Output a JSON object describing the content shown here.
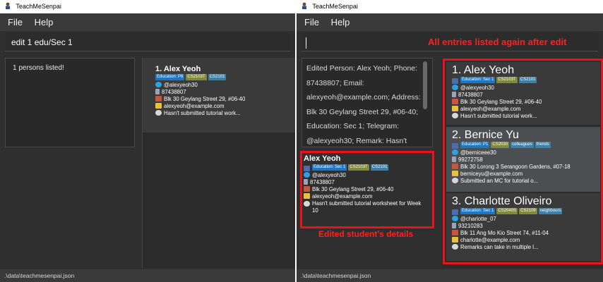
{
  "app_title": "TeachMeSenpai",
  "menu": {
    "file": "File",
    "help": "Help"
  },
  "status_path": ".\\data\\teachmesenpai.json",
  "left": {
    "command_text": "edit 1 edu/Sec 1",
    "result_text": "1 persons listed!",
    "card": {
      "index_name": "1.  Alex Yeoh",
      "tags": [
        "Education: P6",
        "CS2103T",
        "CS2101"
      ],
      "telegram": "@alexyeoh30",
      "phone": "87438807",
      "address": "Blk 30 Geylang Street 29, #06-40",
      "email": "alexyeoh@example.com",
      "remark": "Hasn't submitted tutorial work..."
    }
  },
  "right": {
    "command_text": "",
    "annotation_top": "All entries listed again after edit",
    "annotation_bottom": "Edited student's details",
    "result_text": "Edited Person: Alex Yeoh; Phone: 87438807; Email: alexyeoh@example.com; Address: Blk 30 Geylang Street 29, #06-40; Education: Sec 1; Telegram: @alexyeoh30; Remark: Hasn't submitted",
    "detail": {
      "name": "Alex Yeoh",
      "tags": [
        "Education: Sec 1",
        "CS2103T",
        "CS2101"
      ],
      "telegram": "@alexyeoh30",
      "phone": "87438807",
      "address": "Blk 30 Geylang Street 29, #06-40",
      "email": "alexyeoh@example.com",
      "remark": "Hasn't submitted tutorial worksheet for Week 10"
    },
    "cards": [
      {
        "index_name": "1.  Alex Yeoh",
        "tags": [
          "Education: Sec 1",
          "CS2103T",
          "CS2101"
        ],
        "telegram": "@alexyeoh30",
        "phone": "87438807",
        "address": "Blk 30 Geylang Street 29, #06-40",
        "email": "alexyeoh@example.com",
        "remark": "Hasn't submitted tutorial work..."
      },
      {
        "index_name": "2.  Bernice Yu",
        "tags": [
          "Education: P1",
          "CS2030",
          "colleagues",
          "friends"
        ],
        "telegram": "@berniceee30",
        "phone": "99272758",
        "address": "Blk 30 Lorong 3 Serangoon Gardens, #07-18",
        "email": "berniceyu@example.com",
        "remark": "Submitted an MC for tutorial o..."
      },
      {
        "index_name": "3.  Charlotte Oliveiro",
        "tags": [
          "Education: Sec 1",
          "CS2040S",
          "CS2109",
          "neighbours"
        ],
        "telegram": "@charlotte_07",
        "phone": "93210283",
        "address": "Blk 11 Ang Mo Kio Street 74, #11-04",
        "email": "charlotte@example.com",
        "remark": "Remarks can take in multiple l..."
      }
    ]
  },
  "colors": {
    "education_tag": "#1f77c4",
    "module_tag": "#7f8a3a",
    "other_tag": "#3d7fa6",
    "annotation_red": "#e8131b",
    "window_bg": "#2f2f2f"
  }
}
